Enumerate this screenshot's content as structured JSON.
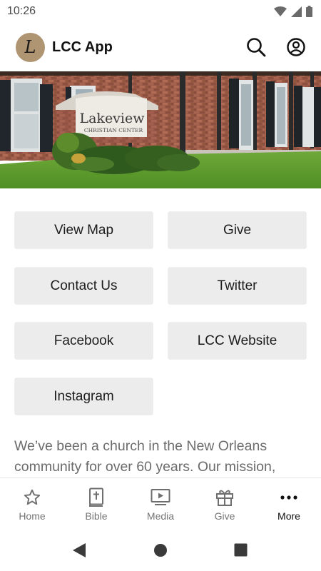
{
  "status_bar": {
    "time": "10:26",
    "icons": [
      "wifi-icon",
      "cellular-icon",
      "battery-icon"
    ]
  },
  "header": {
    "logo_letter": "L",
    "title": "LCC App",
    "actions": [
      "search-icon",
      "account-icon"
    ]
  },
  "hero": {
    "sign_line1": "Lakeview",
    "sign_line2": "CHRISTIAN CENTER"
  },
  "buttons": [
    {
      "label": "View Map"
    },
    {
      "label": "Give"
    },
    {
      "label": "Contact Us"
    },
    {
      "label": "Twitter"
    },
    {
      "label": "Facebook"
    },
    {
      "label": "LCC Website"
    },
    {
      "label": "Instagram"
    }
  ],
  "about": {
    "text": "We’ve been a church in the New Orleans community for over 60 years. Our mission,"
  },
  "bottom_nav": {
    "items": [
      {
        "label": "Home",
        "icon": "star-icon"
      },
      {
        "label": "Bible",
        "icon": "bible-icon"
      },
      {
        "label": "Media",
        "icon": "media-icon"
      },
      {
        "label": "Give",
        "icon": "gift-icon"
      },
      {
        "label": "More",
        "icon": "more-icon"
      }
    ],
    "active": "More"
  },
  "system_nav": [
    "back-icon",
    "home-circle-icon",
    "recents-icon"
  ]
}
